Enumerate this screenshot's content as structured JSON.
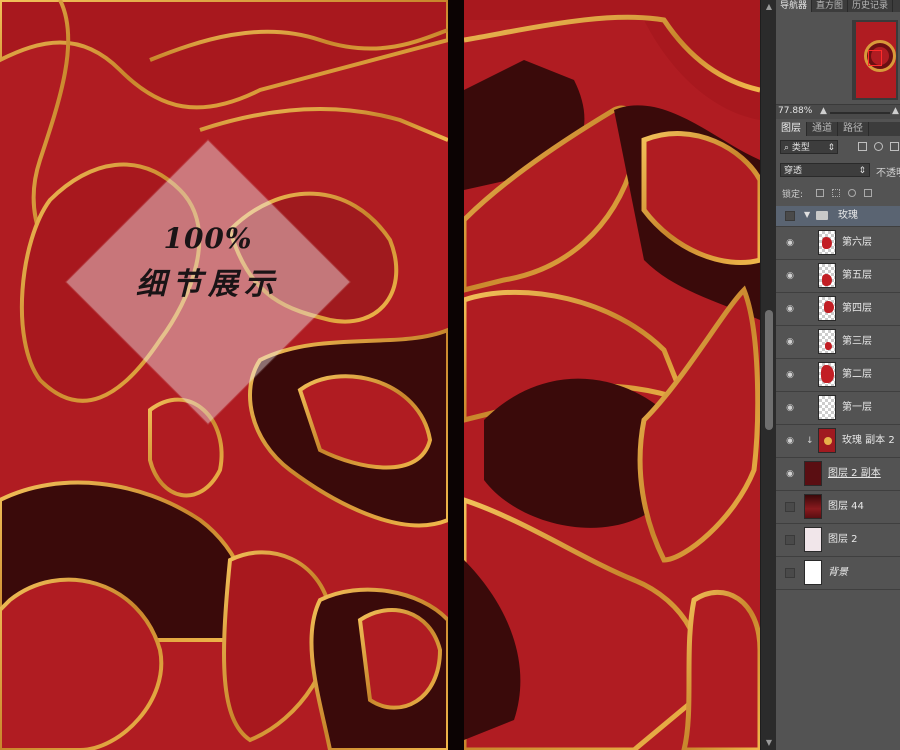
{
  "watermark": {
    "line1": "100%",
    "line2": "细节展示"
  },
  "panel": {
    "tabs": [
      "导航器",
      "直方图",
      "历史记录"
    ],
    "zoom": "77.88%",
    "layer_tabs": [
      "图层",
      "通道",
      "路径"
    ],
    "filter_kind": "类型",
    "blend_mode": "穿透",
    "opacity_label": "不透明",
    "lock_label": "锁定:",
    "layers": [
      {
        "name": "玫瑰",
        "type": "group",
        "visible": false
      },
      {
        "name": "第六层",
        "type": "layer",
        "visible": true
      },
      {
        "name": "第五层",
        "type": "layer",
        "visible": true
      },
      {
        "name": "第四层",
        "type": "layer",
        "visible": true
      },
      {
        "name": "第三层",
        "type": "layer",
        "visible": true
      },
      {
        "name": "第二层",
        "type": "layer",
        "visible": true
      },
      {
        "name": "第一层",
        "type": "layer",
        "visible": true
      },
      {
        "name": "玫瑰 副本 2",
        "type": "layer",
        "visible": true
      },
      {
        "name": "图层 2 副本",
        "type": "layer",
        "visible": true
      },
      {
        "name": "图层 44",
        "type": "layer",
        "visible": false
      },
      {
        "name": "图层 2",
        "type": "layer",
        "visible": false
      },
      {
        "name": "背景",
        "type": "layer",
        "visible": false
      }
    ]
  },
  "colors": {
    "petal": "#b01c22",
    "outline": "#e0a33f",
    "shadow": "#3a0a0a",
    "panel": "#535353"
  }
}
